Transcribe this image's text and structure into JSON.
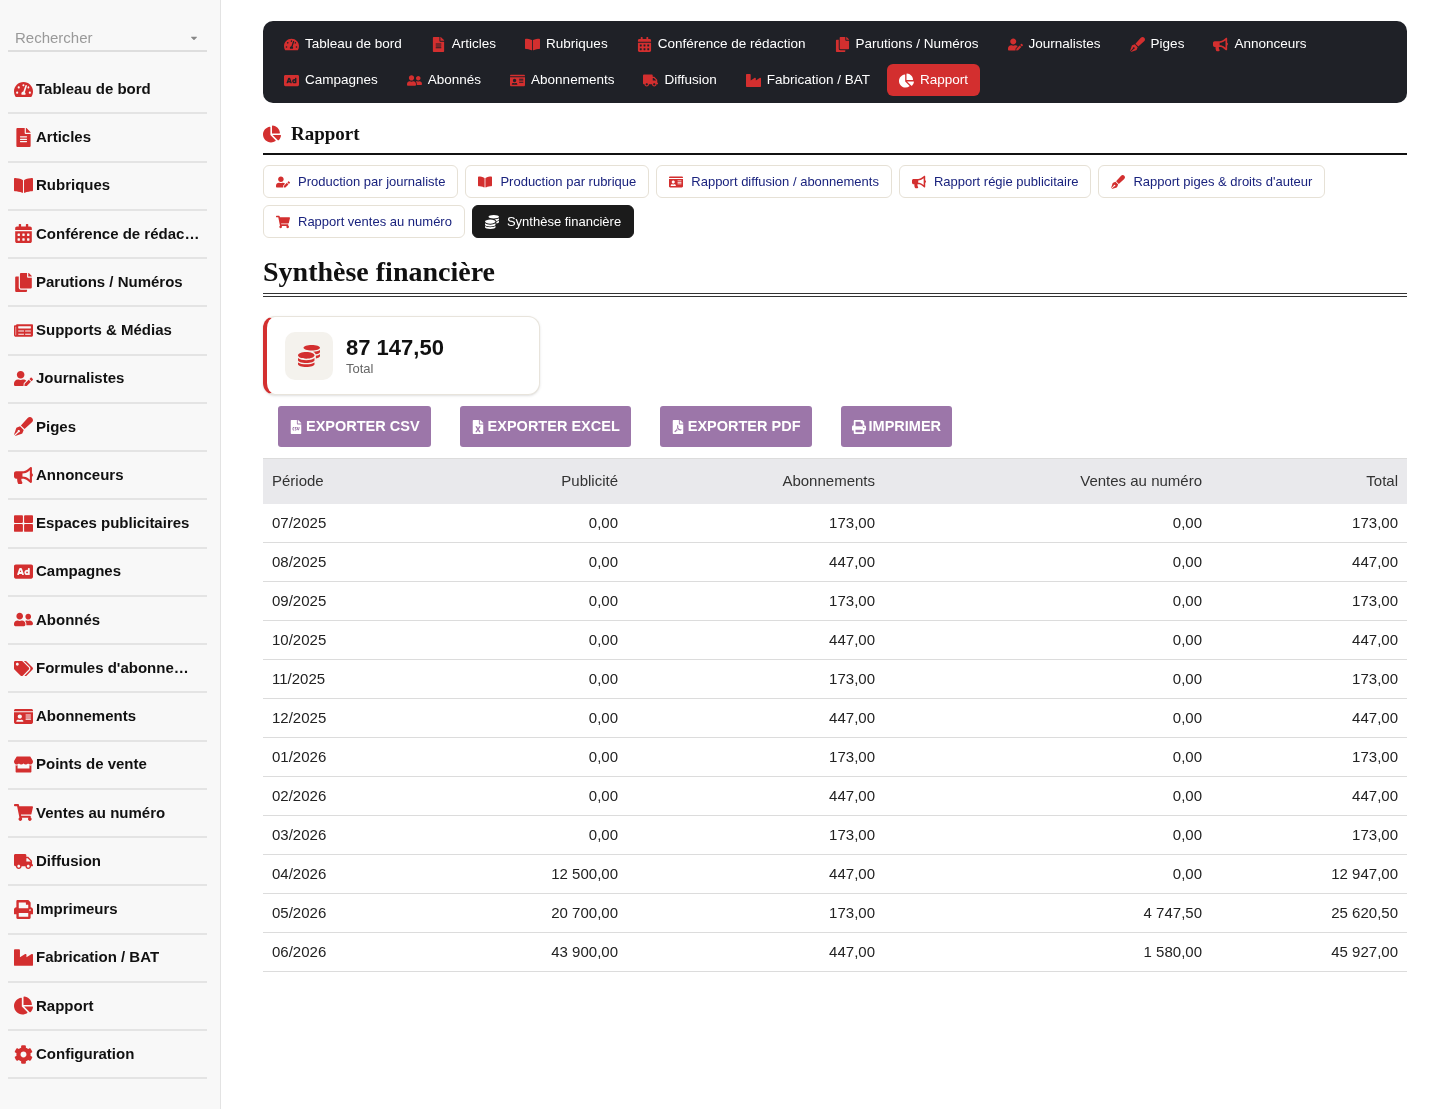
{
  "sidebar": {
    "search": {
      "placeholder": "Rechercher"
    },
    "items": [
      {
        "label": "Tableau de bord"
      },
      {
        "label": "Articles"
      },
      {
        "label": "Rubriques"
      },
      {
        "label": "Conférence de rédac…"
      },
      {
        "label": "Parutions / Numéros"
      },
      {
        "label": "Supports & Médias"
      },
      {
        "label": "Journalistes"
      },
      {
        "label": "Piges"
      },
      {
        "label": "Annonceurs"
      },
      {
        "label": "Espaces publicitaires"
      },
      {
        "label": "Campagnes"
      },
      {
        "label": "Abonnés"
      },
      {
        "label": "Formules d'abonne…"
      },
      {
        "label": "Abonnements"
      },
      {
        "label": "Points de vente"
      },
      {
        "label": "Ventes au numéro"
      },
      {
        "label": "Diffusion"
      },
      {
        "label": "Imprimeurs"
      },
      {
        "label": "Fabrication / BAT"
      },
      {
        "label": "Rapport"
      },
      {
        "label": "Configuration"
      }
    ]
  },
  "top_nav": {
    "items": [
      {
        "label": "Tableau de bord",
        "selected": false
      },
      {
        "label": "Articles",
        "selected": false
      },
      {
        "label": "Rubriques",
        "selected": false
      },
      {
        "label": "Conférence de rédaction",
        "selected": false
      },
      {
        "label": "Parutions / Numéros",
        "selected": false
      },
      {
        "label": "Journalistes",
        "selected": false
      },
      {
        "label": "Piges",
        "selected": false
      },
      {
        "label": "Annonceurs",
        "selected": false
      },
      {
        "label": "Campagnes",
        "selected": false
      },
      {
        "label": "Abonnés",
        "selected": false
      },
      {
        "label": "Abonnements",
        "selected": false
      },
      {
        "label": "Diffusion",
        "selected": false
      },
      {
        "label": "Fabrication / BAT",
        "selected": false
      },
      {
        "label": "Rapport",
        "selected": true
      }
    ]
  },
  "section": {
    "title": "Rapport"
  },
  "report_tabs": [
    {
      "label": "Production par journaliste",
      "selected": false
    },
    {
      "label": "Production par rubrique",
      "selected": false
    },
    {
      "label": "Rapport diffusion / abonnements",
      "selected": false
    },
    {
      "label": "Rapport régie publicitaire",
      "selected": false
    },
    {
      "label": "Rapport piges & droits d'auteur",
      "selected": false
    },
    {
      "label": "Rapport ventes au numéro",
      "selected": false
    },
    {
      "label": "Synthèse financière",
      "selected": true
    }
  ],
  "page_title": "Synthèse financière",
  "stat_card": {
    "value": "87 147,50",
    "label": "Total"
  },
  "actions": [
    {
      "label": "EXPORTER CSV"
    },
    {
      "label": "EXPORTER EXCEL"
    },
    {
      "label": "EXPORTER PDF"
    },
    {
      "label": "IMPRIMER"
    }
  ],
  "table": {
    "columns": [
      "Période",
      "Publicité",
      "Abonnements",
      "Ventes au numéro",
      "Total"
    ],
    "rows": [
      [
        "07/2025",
        "0,00",
        "173,00",
        "0,00",
        "173,00"
      ],
      [
        "08/2025",
        "0,00",
        "447,00",
        "0,00",
        "447,00"
      ],
      [
        "09/2025",
        "0,00",
        "173,00",
        "0,00",
        "173,00"
      ],
      [
        "10/2025",
        "0,00",
        "447,00",
        "0,00",
        "447,00"
      ],
      [
        "11/2025",
        "0,00",
        "173,00",
        "0,00",
        "173,00"
      ],
      [
        "12/2025",
        "0,00",
        "447,00",
        "0,00",
        "447,00"
      ],
      [
        "01/2026",
        "0,00",
        "173,00",
        "0,00",
        "173,00"
      ],
      [
        "02/2026",
        "0,00",
        "447,00",
        "0,00",
        "447,00"
      ],
      [
        "03/2026",
        "0,00",
        "173,00",
        "0,00",
        "173,00"
      ],
      [
        "04/2026",
        "12 500,00",
        "447,00",
        "0,00",
        "12 947,00"
      ],
      [
        "05/2026",
        "20 700,00",
        "173,00",
        "4 747,50",
        "25 620,50"
      ],
      [
        "06/2026",
        "43 900,00",
        "447,00",
        "1 580,00",
        "45 927,00"
      ]
    ]
  }
}
